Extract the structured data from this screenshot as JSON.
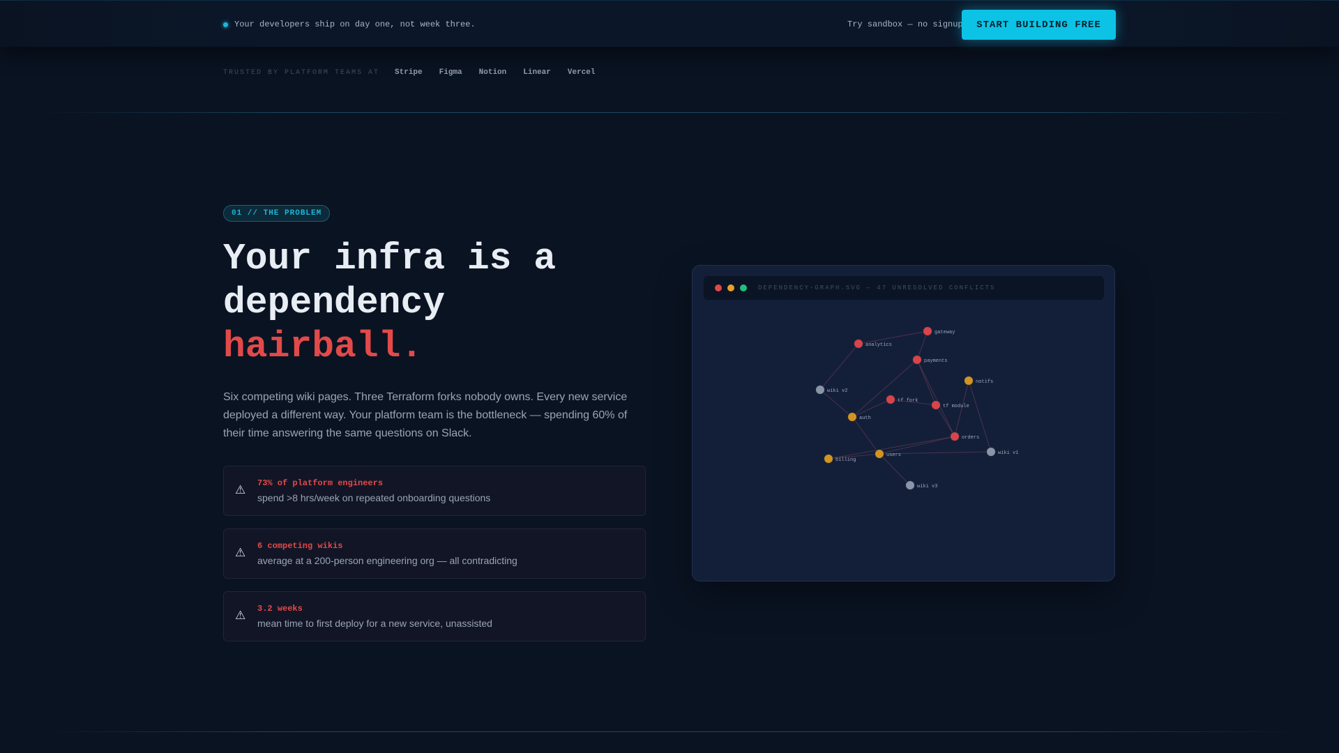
{
  "topbar": {
    "tagline": "Your developers ship on day one, not week three.",
    "sandbox": "Try sandbox — no signup",
    "cta": "START BUILDING FREE"
  },
  "trusted": {
    "label": "TRUSTED BY PLATFORM TEAMS AT",
    "logos": [
      "Stripe",
      "Figma",
      "Notion",
      "Linear",
      "Vercel"
    ]
  },
  "section": {
    "badge": "01 // THE PROBLEM",
    "headline_line1": "Your infra is a",
    "headline_line2": "dependency",
    "headline_accent": "hairball.",
    "description": "Six competing wiki pages. Three Terraform forks nobody owns. Every new service deployed a different way. Your platform team is the bottleneck — spending 60% of their time answering the same questions on Slack."
  },
  "stats": [
    {
      "icon": "⚠",
      "title": "73% of platform engineers",
      "body": "spend >8 hrs/week on repeated onboarding questions"
    },
    {
      "icon": "⚠",
      "title": "6 competing wikis",
      "body": "average at a 200-person engineering org — all contradicting"
    },
    {
      "icon": "⚠",
      "title": "3.2 weeks",
      "body": "mean time to first deploy for a new service, unassisted"
    }
  ],
  "graph_panel": {
    "title": "DEPENDENCY-GRAPH.SVG — 47 UNRESOLVED CONFLICTS",
    "colors": {
      "critical": "#d9434a",
      "warning": "#d4941f",
      "neutral": "#8a96a8"
    },
    "nodes": [
      {
        "label": "gateway",
        "status": "critical"
      },
      {
        "label": "analytics",
        "status": "critical"
      },
      {
        "label": "payments",
        "status": "critical"
      },
      {
        "label": "notifs",
        "status": "warning"
      },
      {
        "label": "wiki v2",
        "status": "neutral"
      },
      {
        "label": "tf fork",
        "status": "critical"
      },
      {
        "label": "tf module",
        "status": "critical"
      },
      {
        "label": "auth",
        "status": "warning"
      },
      {
        "label": "orders",
        "status": "critical"
      },
      {
        "label": "wiki v1",
        "status": "neutral"
      },
      {
        "label": "billing",
        "status": "warning"
      },
      {
        "label": "users",
        "status": "warning"
      },
      {
        "label": "wiki v3",
        "status": "neutral"
      }
    ],
    "edges": [
      [
        "analytics",
        "gateway"
      ],
      [
        "analytics",
        "wiki v2"
      ],
      [
        "gateway",
        "payments"
      ],
      [
        "payments",
        "auth"
      ],
      [
        "payments",
        "tf module"
      ],
      [
        "payments",
        "orders"
      ],
      [
        "wiki v2",
        "auth"
      ],
      [
        "auth",
        "tf fork"
      ],
      [
        "tf fork",
        "tf module"
      ],
      [
        "tf module",
        "orders"
      ],
      [
        "notifs",
        "orders"
      ],
      [
        "notifs",
        "wiki v1"
      ],
      [
        "auth",
        "users"
      ],
      [
        "users",
        "orders"
      ],
      [
        "users",
        "wiki v1"
      ],
      [
        "billing",
        "users"
      ],
      [
        "billing",
        "orders"
      ],
      [
        "users",
        "wiki v3"
      ]
    ]
  }
}
